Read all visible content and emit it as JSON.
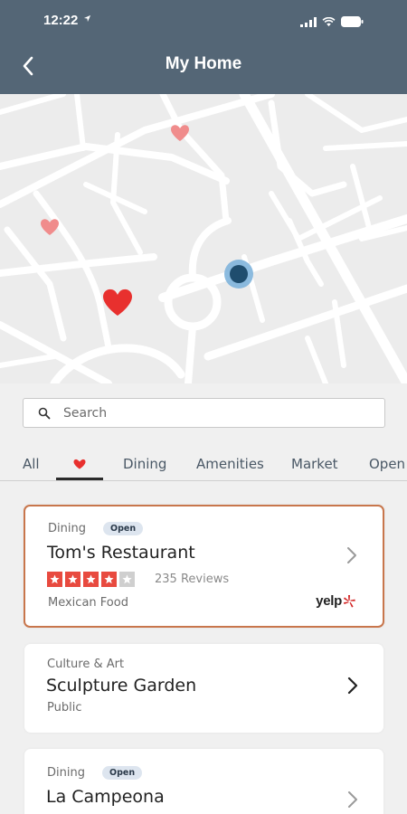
{
  "status": {
    "time": "12:22"
  },
  "header": {
    "title": "My Home"
  },
  "search": {
    "placeholder": "Search"
  },
  "tabs": {
    "all": "All",
    "dining": "Dining",
    "amenities": "Amenities",
    "market": "Market",
    "open": "Open"
  },
  "listings": [
    {
      "category": "Dining",
      "badge": "Open",
      "name": "Tom's Restaurant",
      "rating": 4,
      "max_rating": 5,
      "reviews": "235 Reviews",
      "subtitle": "Mexican Food",
      "source": "yelp",
      "selected": true
    },
    {
      "category": "Culture & Art",
      "name": "Sculpture Garden",
      "subtitle": "Public",
      "selected": false
    },
    {
      "category": "Dining",
      "badge": "Open",
      "name": "La Campeona",
      "selected": false
    }
  ],
  "colors": {
    "header": "#546676",
    "heart": "#e8302e",
    "heart_light": "#f08c8c",
    "selected_border": "#c8764c",
    "star": "#e84a3f",
    "location_dot": "#1f4d6e"
  }
}
